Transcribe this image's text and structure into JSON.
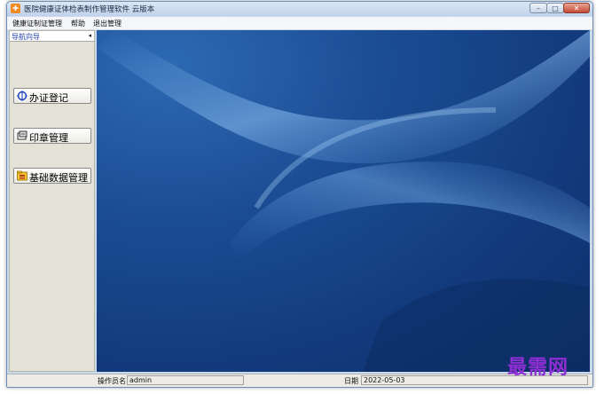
{
  "window": {
    "title": "医院健康证体检表制作管理软件 云版本",
    "controls": {
      "minimize": "–",
      "maximize": "□",
      "close": "✕"
    }
  },
  "menubar": {
    "items": [
      "健康证制证管理",
      "帮助",
      "退出管理"
    ]
  },
  "nav": {
    "title": "导航向导",
    "collapse_glyph": "◂",
    "buttons": [
      {
        "label": "办证登记",
        "icon": "move-arrows-icon"
      },
      {
        "label": "印章管理",
        "icon": "stamp-icon"
      },
      {
        "label": "基础数据管理",
        "icon": "database-folder-icon"
      }
    ]
  },
  "status": {
    "operator_label": "操作员名",
    "operator_value": "admin",
    "date_label": "日期",
    "date_value": "2022-05-03"
  },
  "watermark": "最需网",
  "colors": {
    "desktop_bg": "#1b4d94",
    "nav_bg": "#e4e2d7",
    "nav_title": "#1f3fae",
    "watermark": "#8e2fd4"
  }
}
